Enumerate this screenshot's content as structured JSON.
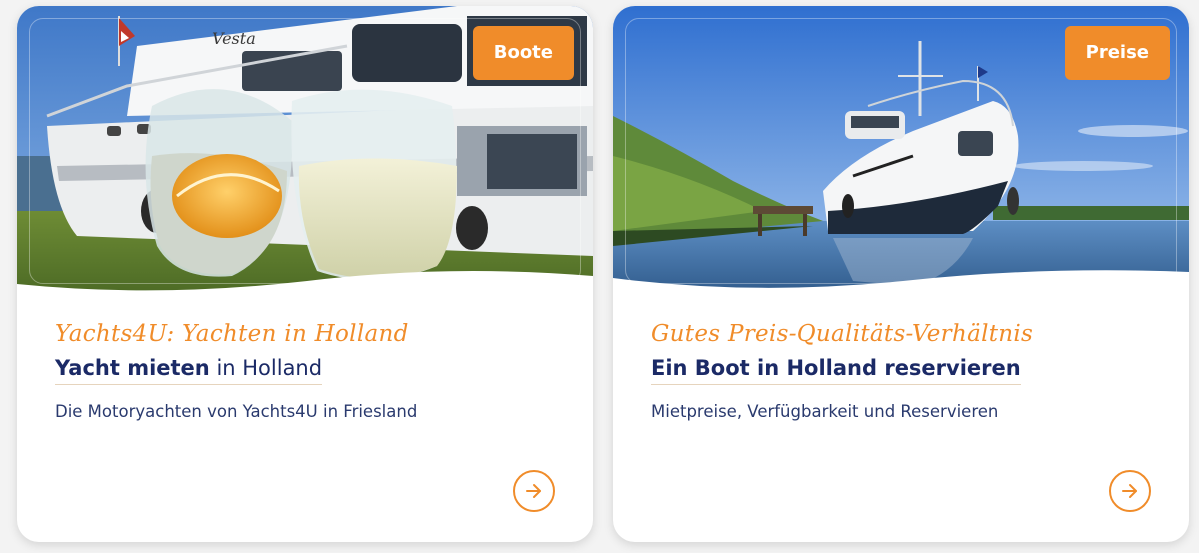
{
  "cards": [
    {
      "badge": "Boote",
      "tagline": "Yachts4U: Yachten in Holland",
      "headline_bold": "Yacht mieten",
      "headline_rest": " in Holland",
      "description": "Die Motoryachten von Yachts4U in Friesland",
      "boat_name": "Vesta",
      "image_alt": "two drinking glasses in front of a motor yacht",
      "link_icon": "arrow-right-circle-icon"
    },
    {
      "badge": "Preise",
      "tagline": "Gutes Preis-Qualitäts-Verhältnis",
      "headline_bold": "Ein Boot in Holland reservieren",
      "headline_rest": "",
      "description": "Mietpreise, Verfügbarkeit und Reservieren",
      "image_alt": "white motor yacht on a canal",
      "link_icon": "arrow-right-circle-icon"
    }
  ],
  "colors": {
    "accent": "#f08c2a",
    "headline": "#1b2a66",
    "text": "#2a3a6e",
    "card": "#ffffff"
  }
}
